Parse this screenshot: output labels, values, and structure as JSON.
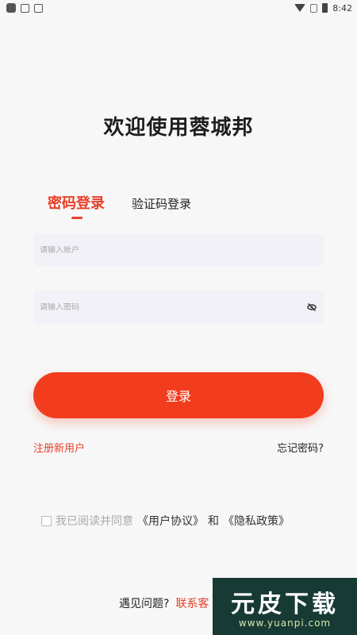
{
  "status_bar": {
    "time": "8:42"
  },
  "title": "欢迎使用蓉城邦",
  "tabs": [
    {
      "label": "密码登录",
      "active": true
    },
    {
      "label": "验证码登录",
      "active": false
    }
  ],
  "account_field": {
    "placeholder": "请输入账户",
    "value": ""
  },
  "password_field": {
    "placeholder": "请输入密码",
    "value": ""
  },
  "login_button": {
    "label": "登录"
  },
  "register_link": "注册新用户",
  "forgot_link": "忘记密码?",
  "agreement": {
    "checked": false,
    "prefix": "我已阅读并同意",
    "user_agreement": "《用户协议》",
    "and": "和",
    "privacy_policy": "《隐私政策》"
  },
  "help": {
    "question": "遇见问题?",
    "contact": "联系客"
  },
  "watermark": {
    "title": "元皮下载",
    "url": "www.yuanpi.com"
  },
  "colors": {
    "accent": "#e8402a",
    "button": "#f13c1e",
    "field_bg": "#f2f1f8"
  },
  "icons": [
    "eye-off-icon",
    "wifi-icon",
    "battery-icon"
  ]
}
